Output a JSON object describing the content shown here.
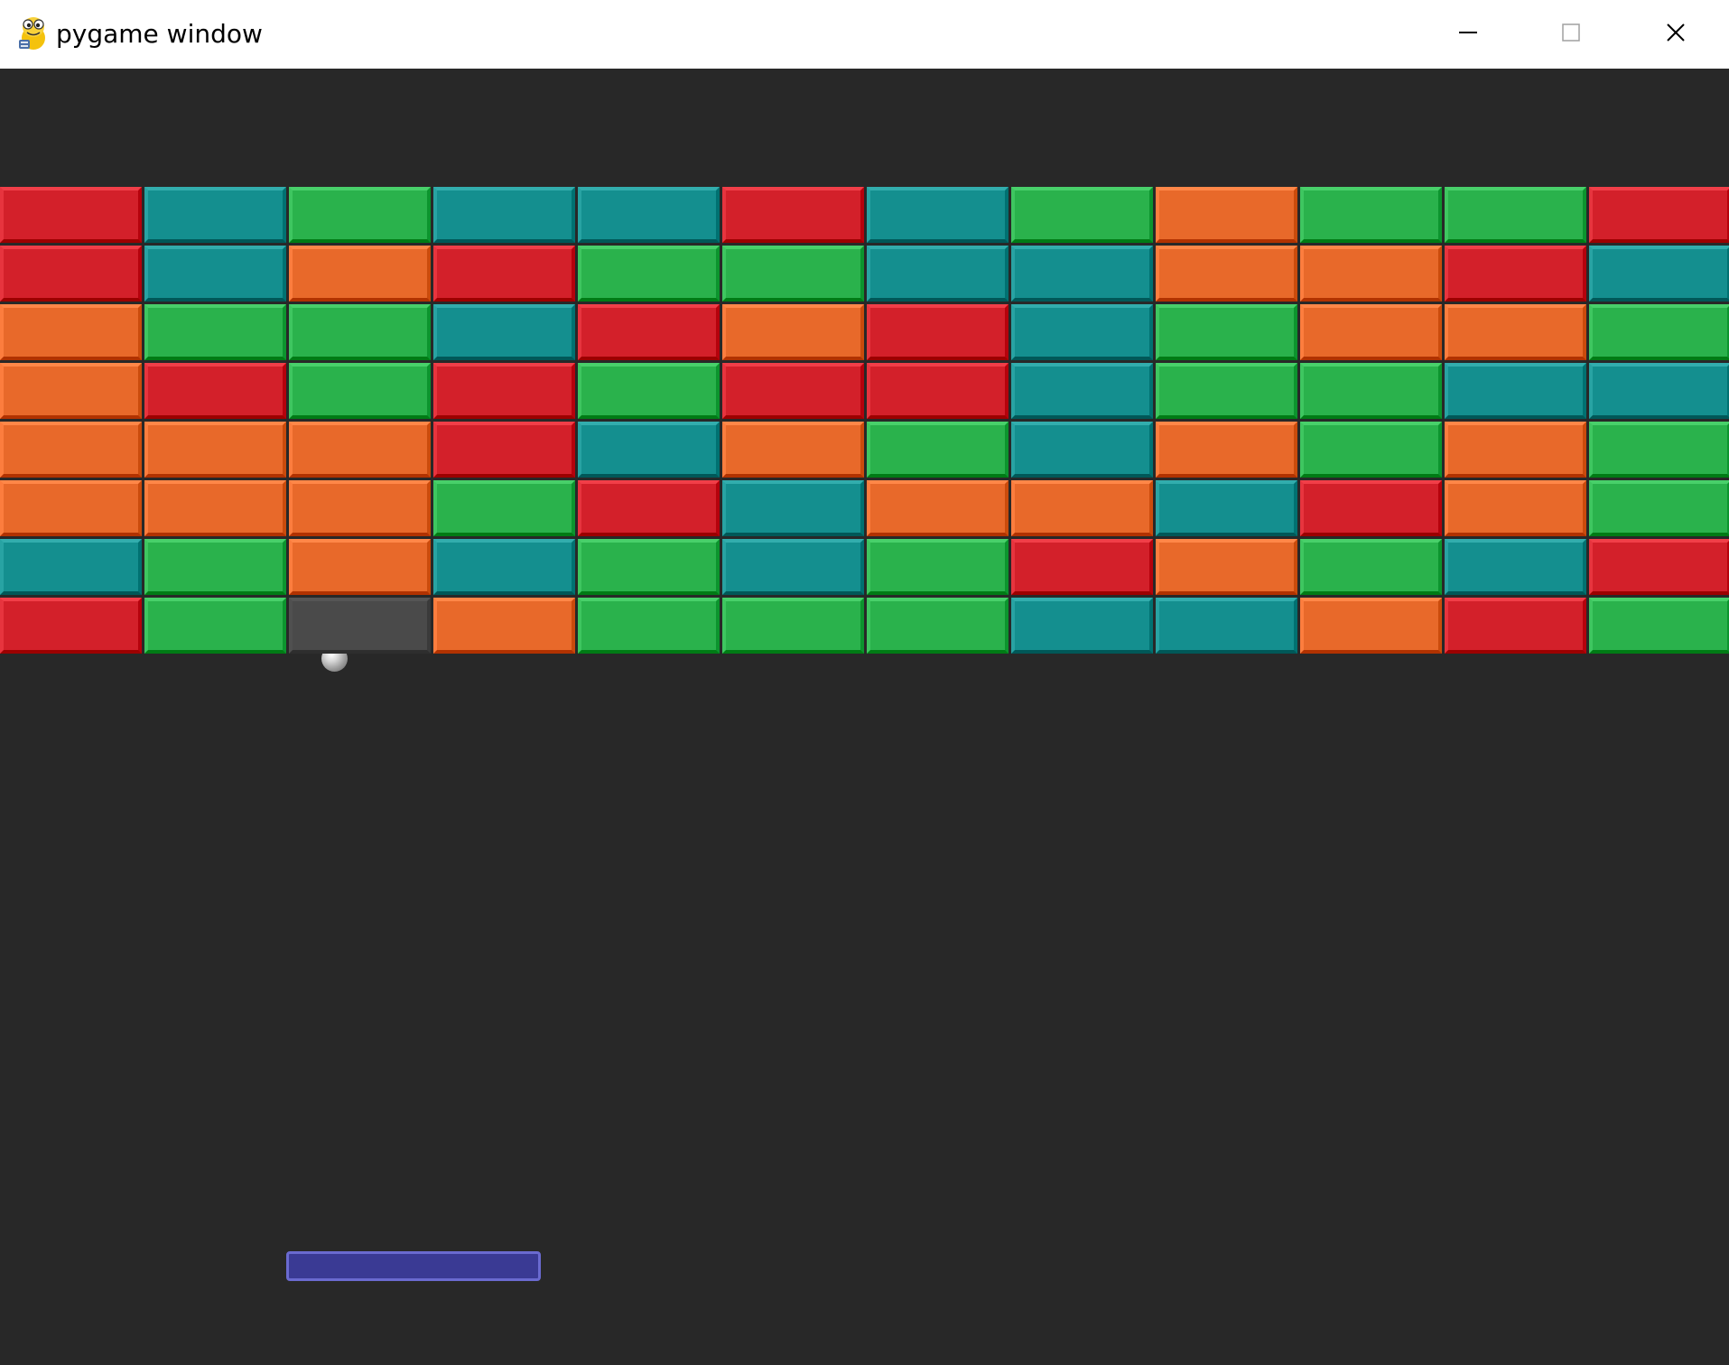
{
  "window": {
    "title": "pygame window",
    "controls": {
      "minimize_icon": "minimize-icon",
      "maximize_icon": "maximize-icon",
      "close_icon": "close-icon"
    }
  },
  "colors": {
    "background": "#282828",
    "R": "#d3202a",
    "T": "#148f8f",
    "G": "#2ab24c",
    "O": "#e8692a",
    "paddle": "#3a3a94"
  },
  "bricks": {
    "columns": 12,
    "legend": {
      "R": "red",
      "T": "teal",
      "G": "green",
      "O": "orange",
      "X": "destroyed"
    },
    "rows": [
      [
        "R",
        "T",
        "G",
        "T",
        "T",
        "R",
        "T",
        "G",
        "O",
        "G",
        "G",
        "R"
      ],
      [
        "R",
        "T",
        "O",
        "R",
        "G",
        "G",
        "T",
        "T",
        "O",
        "O",
        "R",
        "T"
      ],
      [
        "O",
        "G",
        "G",
        "T",
        "R",
        "O",
        "R",
        "T",
        "G",
        "O",
        "O",
        "G"
      ],
      [
        "O",
        "R",
        "G",
        "R",
        "G",
        "R",
        "R",
        "T",
        "G",
        "G",
        "T",
        "T"
      ],
      [
        "O",
        "O",
        "O",
        "R",
        "T",
        "O",
        "G",
        "T",
        "O",
        "G",
        "O",
        "G"
      ],
      [
        "O",
        "O",
        "O",
        "G",
        "R",
        "T",
        "O",
        "O",
        "T",
        "R",
        "O",
        "G"
      ],
      [
        "T",
        "G",
        "O",
        "T",
        "G",
        "T",
        "G",
        "R",
        "O",
        "G",
        "T",
        "R"
      ],
      [
        "R",
        "G",
        "X",
        "O",
        "G",
        "G",
        "G",
        "T",
        "T",
        "O",
        "R",
        "G"
      ]
    ]
  },
  "ball": {
    "name": "ball"
  },
  "paddle": {
    "name": "paddle"
  }
}
